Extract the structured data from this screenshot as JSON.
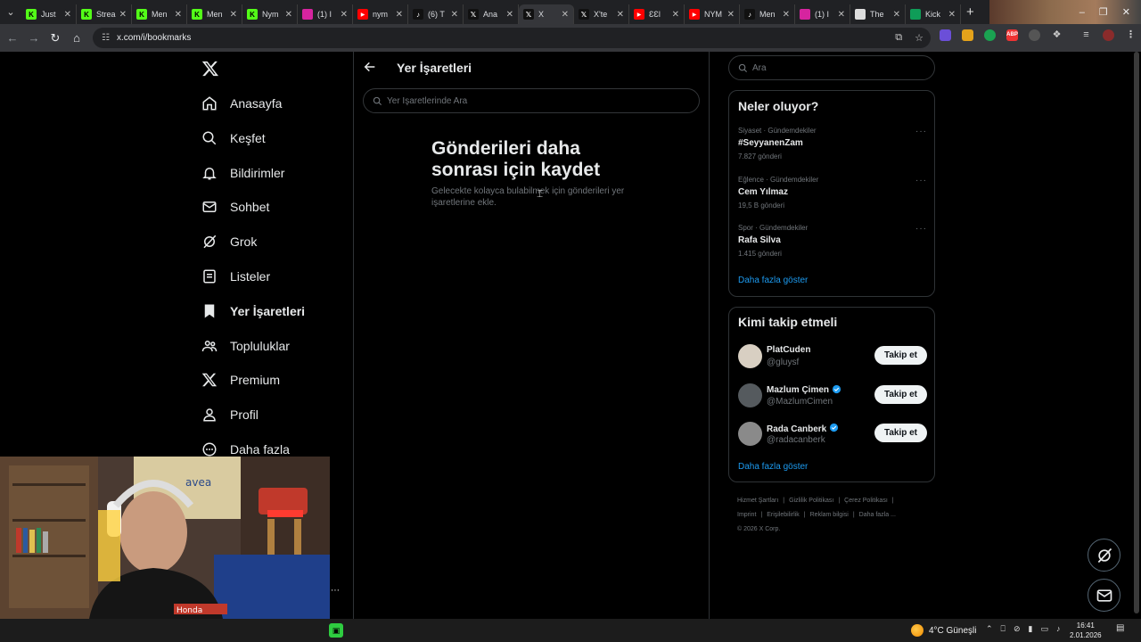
{
  "browser": {
    "tabs": [
      {
        "label": "Just",
        "icon": "kick-icon",
        "color": "#53fc18"
      },
      {
        "label": "Strea",
        "icon": "kick-icon",
        "color": "#53fc18"
      },
      {
        "label": "Men",
        "icon": "kick-icon",
        "color": "#53fc18"
      },
      {
        "label": "Men",
        "icon": "kick-icon",
        "color": "#53fc18"
      },
      {
        "label": "Nym",
        "icon": "kick-icon",
        "color": "#53fc18"
      },
      {
        "label": "(1) I",
        "icon": "instagram-icon",
        "color": "#d6249f"
      },
      {
        "label": "nym",
        "icon": "youtube-icon",
        "color": "#ff0000"
      },
      {
        "label": "(6) T",
        "icon": "tiktok-icon",
        "color": "#111111"
      },
      {
        "label": "Ana",
        "icon": "x-icon",
        "color": "#111111"
      },
      {
        "label": "X",
        "icon": "x-icon",
        "color": "#111111",
        "active": true
      },
      {
        "label": "X'te",
        "icon": "x-icon",
        "color": "#111111"
      },
      {
        "label": "ƐƐl",
        "icon": "youtube-icon",
        "color": "#ff0000"
      },
      {
        "label": "NYM",
        "icon": "youtube-icon",
        "color": "#ff0000"
      },
      {
        "label": "Men",
        "icon": "tiktok-icon",
        "color": "#111111"
      },
      {
        "label": "(1) I",
        "icon": "instagram-icon",
        "color": "#d6249f"
      },
      {
        "label": "The",
        "icon": "site-icon",
        "color": "#dddddd"
      },
      {
        "label": "Kick",
        "icon": "sheets-icon",
        "color": "#0f9d58"
      }
    ],
    "url": "x.com/i/bookmarks"
  },
  "nav": {
    "items": [
      {
        "label": "Anasayfa",
        "icon": "home-icon"
      },
      {
        "label": "Keşfet",
        "icon": "search-icon"
      },
      {
        "label": "Bildirimler",
        "icon": "bell-icon"
      },
      {
        "label": "Sohbet",
        "icon": "mail-icon"
      },
      {
        "label": "Grok",
        "icon": "grok-icon"
      },
      {
        "label": "Listeler",
        "icon": "list-icon"
      },
      {
        "label": "Yer İşaretleri",
        "icon": "bookmark-icon",
        "current": true
      },
      {
        "label": "Topluluklar",
        "icon": "communities-icon"
      },
      {
        "label": "Premium",
        "icon": "x-icon"
      },
      {
        "label": "Profil",
        "icon": "profile-icon"
      },
      {
        "label": "Daha fazla",
        "icon": "more-circle-icon"
      }
    ]
  },
  "main": {
    "title": "Yer İşaretleri",
    "search_placeholder": "Yer İşaretlerinde Ara",
    "empty_title": "Gönderileri daha sonrası için kaydet",
    "empty_desc": "Gelecekte kolayca bulabilmek için gönderileri yer işaretlerine ekle."
  },
  "right": {
    "search_placeholder": "Ara",
    "trends_title": "Neler oluyor?",
    "trends": [
      {
        "meta": "Siyaset · Gündemdekiler",
        "name": "#SeyyanenZam",
        "count": "7.827 gönderi"
      },
      {
        "meta": "Eğlence · Gündemdekiler",
        "name": "Cem Yılmaz",
        "count": "19,5 B gönderi"
      },
      {
        "meta": "Spor · Gündemdekiler",
        "name": "Rafa Silva",
        "count": "1.415 gönderi"
      }
    ],
    "trends_more": "Daha fazla göster",
    "follow_title": "Kimi takip etmeli",
    "follow": [
      {
        "name": "PlatCuden",
        "handle": "@gluysf",
        "verified": false,
        "button": "Takip et"
      },
      {
        "name": "Mazlum Çimen",
        "handle": "@MazlumCimen",
        "verified": true,
        "button": "Takip et"
      },
      {
        "name": "Rada Canberk",
        "handle": "@radacanberk",
        "verified": true,
        "button": "Takip et"
      }
    ],
    "follow_more": "Daha fazla göster",
    "footer": {
      "links_row1": [
        "Hizmet Şartları",
        "Gizlilik Politikası",
        "Çerez Politikası"
      ],
      "links_row2": [
        "Imprint",
        "Erişilebilirlik",
        "Reklam bilgisi",
        "Daha fazla ..."
      ],
      "copyright": "© 2026 X Corp."
    }
  },
  "taskbar": {
    "weather": "4°C  Güneşli",
    "time": "16:41",
    "date": "2.01.2026"
  },
  "colors": {
    "accent": "#1d9bf0",
    "background": "#000000",
    "border": "#2f3336"
  }
}
